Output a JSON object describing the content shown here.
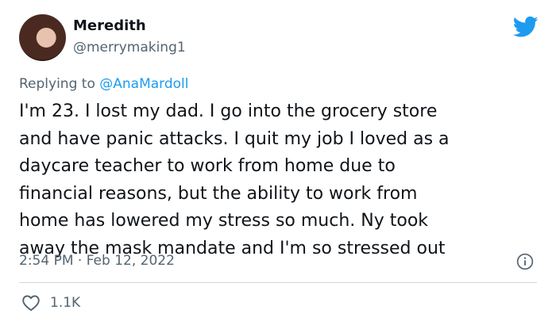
{
  "author": {
    "display_name": "Meredith",
    "handle": "@merrymaking1"
  },
  "reply": {
    "prefix": "Replying to ",
    "mention": "@AnaMardoll"
  },
  "tweet": {
    "text": "I'm 23. I lost my dad. I go into the grocery store\nand have panic attacks. I quit my job I loved as a\ndaycare teacher to work from home due to\nfinancial reasons, but the ability to work from\nhome has lowered my stress so much. Ny took\naway the mask mandate and I'm so stressed out",
    "timestamp": "2:54 PM · Feb 12, 2022"
  },
  "engagement": {
    "likes": "1.1K"
  },
  "icons": {
    "brand": "twitter-bird-icon",
    "info": "info-icon",
    "like": "heart-icon"
  },
  "colors": {
    "brand": "#1d9bf0",
    "text": "#0f1419",
    "secondary": "#536471",
    "divider": "#cfd9de"
  }
}
